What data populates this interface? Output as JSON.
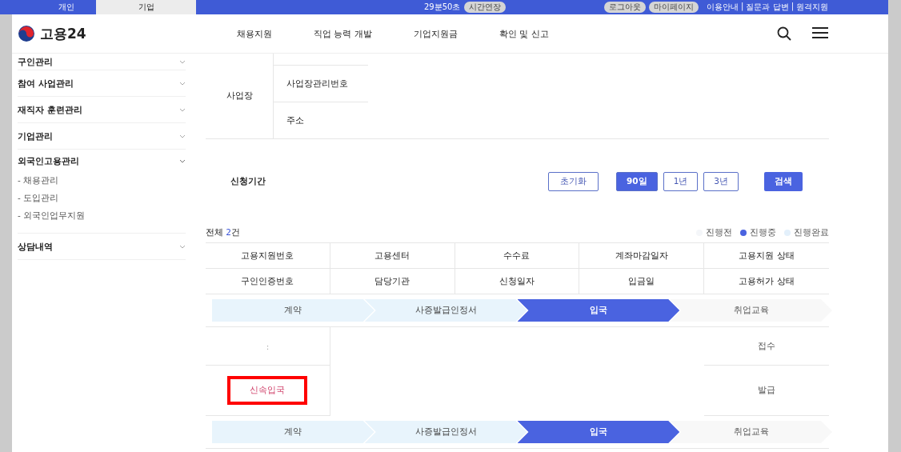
{
  "top_bar": {
    "tabs": [
      {
        "label": "개인",
        "selected": false
      },
      {
        "label": "기업",
        "selected": true
      }
    ],
    "session_time": "29분50초",
    "extend_button": "시간연장",
    "account_buttons": [
      "로그아웃",
      "마이페이지"
    ],
    "links": [
      "이용안내",
      "질문과 답변",
      "원격지원"
    ],
    "link_separator": "|"
  },
  "header": {
    "logo": "고용24",
    "nav": [
      "채용지원",
      "직업 능력 개발",
      "기업지원금",
      "확인 및 신고"
    ]
  },
  "sidebar": {
    "items": [
      {
        "label": "구인관리",
        "expanded": false
      },
      {
        "label": "참여 사업관리",
        "expanded": false
      },
      {
        "label": "재직자 훈련관리",
        "expanded": false
      },
      {
        "label": "기업관리",
        "expanded": false
      },
      {
        "label": "외국인고용관리",
        "expanded": true,
        "children": [
          {
            "label": "- 채용관리"
          },
          {
            "label": "- 도입관리"
          },
          {
            "label": "- 외국인업무지원"
          }
        ]
      },
      {
        "label": "상담내역",
        "expanded": false
      }
    ]
  },
  "info_table": {
    "group": "사업장",
    "fields": [
      "사업장관리번호",
      "주소"
    ]
  },
  "period": {
    "label": "신청기간",
    "reset_button": "초기화",
    "options": [
      {
        "label": "90일",
        "selected": true
      },
      {
        "label": "1년",
        "selected": false
      },
      {
        "label": "3년",
        "selected": false
      }
    ],
    "search_button": "검색"
  },
  "summary": {
    "prefix": "전체",
    "count": "2",
    "suffix": "건"
  },
  "legend": [
    {
      "label": "진행전",
      "color": "#f4f6f9"
    },
    {
      "label": "진행중",
      "color": "#4a63e0"
    },
    {
      "label": "진행완료",
      "color": "#e3f0fb"
    }
  ],
  "table": {
    "header_rows": [
      [
        "고용지원번호",
        "고용센터",
        "수수료",
        "계좌마감일자",
        "고용지원 상태"
      ],
      [
        "구인인증번호",
        "담당기관",
        "신청일자",
        "입금일",
        "고용허가 상태"
      ]
    ],
    "records": [
      {
        "steps": [
          {
            "label": "계약",
            "completed": true,
            "current": false
          },
          {
            "label": "사증발급인정서",
            "completed": true,
            "current": false
          },
          {
            "label": "입국",
            "completed": false,
            "current": true
          },
          {
            "label": "취업교육",
            "completed": false,
            "current": false
          }
        ],
        "rows": [
          {
            "column_1": ":",
            "column_5": "접수",
            "highlighted": false
          },
          {
            "column_1": "신속입국",
            "column_5": "발급",
            "highlighted": true
          }
        ]
      },
      {
        "steps": [
          {
            "label": "계약",
            "completed": true,
            "current": false
          },
          {
            "label": "사증발급인정서",
            "completed": true,
            "current": false
          },
          {
            "label": "입국",
            "completed": false,
            "current": true
          },
          {
            "label": "취업교육",
            "completed": false,
            "current": false
          }
        ]
      }
    ]
  }
}
